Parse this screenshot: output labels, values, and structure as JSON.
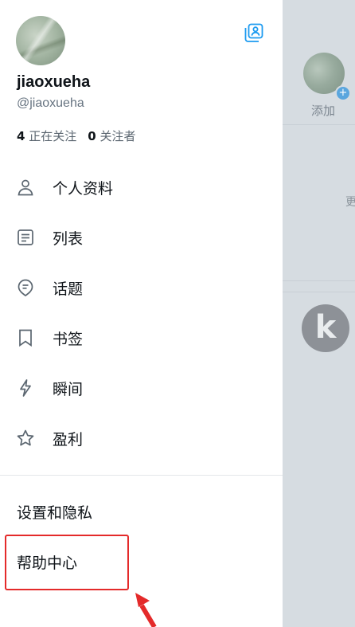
{
  "background": {
    "add_label": "添加",
    "more_label": "更",
    "avatar_letter": "k"
  },
  "profile": {
    "name": "jiaoxueha",
    "handle": "@jiaoxueha",
    "following_count": "4",
    "following_label": "正在关注",
    "followers_count": "0",
    "followers_label": "关注者"
  },
  "menu": {
    "items": [
      {
        "label": "个人资料",
        "icon": "person-icon"
      },
      {
        "label": "列表",
        "icon": "list-icon"
      },
      {
        "label": "话题",
        "icon": "topic-icon"
      },
      {
        "label": "书签",
        "icon": "bookmark-icon"
      },
      {
        "label": "瞬间",
        "icon": "lightning-icon"
      },
      {
        "label": "盈利",
        "icon": "star-icon"
      }
    ],
    "settings_label": "设置和隐私",
    "help_label": "帮助中心"
  },
  "colors": {
    "accent": "#1d9bf0",
    "annotation": "#e42a2a",
    "backdrop": "#d6dce1"
  }
}
